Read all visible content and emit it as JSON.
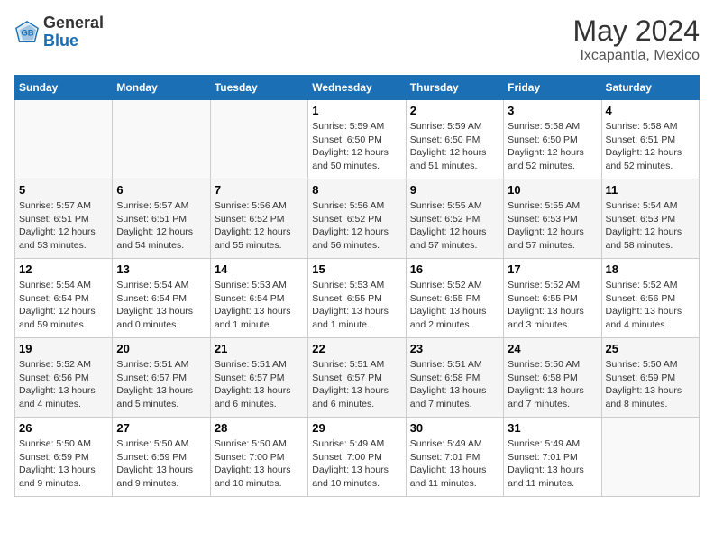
{
  "header": {
    "logo_general": "General",
    "logo_blue": "Blue",
    "month_title": "May 2024",
    "location": "Ixcapantla, Mexico"
  },
  "days_of_week": [
    "Sunday",
    "Monday",
    "Tuesday",
    "Wednesday",
    "Thursday",
    "Friday",
    "Saturday"
  ],
  "weeks": [
    [
      {
        "day": "",
        "content": ""
      },
      {
        "day": "",
        "content": ""
      },
      {
        "day": "",
        "content": ""
      },
      {
        "day": "1",
        "content": "Sunrise: 5:59 AM\nSunset: 6:50 PM\nDaylight: 12 hours\nand 50 minutes."
      },
      {
        "day": "2",
        "content": "Sunrise: 5:59 AM\nSunset: 6:50 PM\nDaylight: 12 hours\nand 51 minutes."
      },
      {
        "day": "3",
        "content": "Sunrise: 5:58 AM\nSunset: 6:50 PM\nDaylight: 12 hours\nand 52 minutes."
      },
      {
        "day": "4",
        "content": "Sunrise: 5:58 AM\nSunset: 6:51 PM\nDaylight: 12 hours\nand 52 minutes."
      }
    ],
    [
      {
        "day": "5",
        "content": "Sunrise: 5:57 AM\nSunset: 6:51 PM\nDaylight: 12 hours\nand 53 minutes."
      },
      {
        "day": "6",
        "content": "Sunrise: 5:57 AM\nSunset: 6:51 PM\nDaylight: 12 hours\nand 54 minutes."
      },
      {
        "day": "7",
        "content": "Sunrise: 5:56 AM\nSunset: 6:52 PM\nDaylight: 12 hours\nand 55 minutes."
      },
      {
        "day": "8",
        "content": "Sunrise: 5:56 AM\nSunset: 6:52 PM\nDaylight: 12 hours\nand 56 minutes."
      },
      {
        "day": "9",
        "content": "Sunrise: 5:55 AM\nSunset: 6:52 PM\nDaylight: 12 hours\nand 57 minutes."
      },
      {
        "day": "10",
        "content": "Sunrise: 5:55 AM\nSunset: 6:53 PM\nDaylight: 12 hours\nand 57 minutes."
      },
      {
        "day": "11",
        "content": "Sunrise: 5:54 AM\nSunset: 6:53 PM\nDaylight: 12 hours\nand 58 minutes."
      }
    ],
    [
      {
        "day": "12",
        "content": "Sunrise: 5:54 AM\nSunset: 6:54 PM\nDaylight: 12 hours\nand 59 minutes."
      },
      {
        "day": "13",
        "content": "Sunrise: 5:54 AM\nSunset: 6:54 PM\nDaylight: 13 hours\nand 0 minutes."
      },
      {
        "day": "14",
        "content": "Sunrise: 5:53 AM\nSunset: 6:54 PM\nDaylight: 13 hours\nand 1 minute."
      },
      {
        "day": "15",
        "content": "Sunrise: 5:53 AM\nSunset: 6:55 PM\nDaylight: 13 hours\nand 1 minute."
      },
      {
        "day": "16",
        "content": "Sunrise: 5:52 AM\nSunset: 6:55 PM\nDaylight: 13 hours\nand 2 minutes."
      },
      {
        "day": "17",
        "content": "Sunrise: 5:52 AM\nSunset: 6:55 PM\nDaylight: 13 hours\nand 3 minutes."
      },
      {
        "day": "18",
        "content": "Sunrise: 5:52 AM\nSunset: 6:56 PM\nDaylight: 13 hours\nand 4 minutes."
      }
    ],
    [
      {
        "day": "19",
        "content": "Sunrise: 5:52 AM\nSunset: 6:56 PM\nDaylight: 13 hours\nand 4 minutes."
      },
      {
        "day": "20",
        "content": "Sunrise: 5:51 AM\nSunset: 6:57 PM\nDaylight: 13 hours\nand 5 minutes."
      },
      {
        "day": "21",
        "content": "Sunrise: 5:51 AM\nSunset: 6:57 PM\nDaylight: 13 hours\nand 6 minutes."
      },
      {
        "day": "22",
        "content": "Sunrise: 5:51 AM\nSunset: 6:57 PM\nDaylight: 13 hours\nand 6 minutes."
      },
      {
        "day": "23",
        "content": "Sunrise: 5:51 AM\nSunset: 6:58 PM\nDaylight: 13 hours\nand 7 minutes."
      },
      {
        "day": "24",
        "content": "Sunrise: 5:50 AM\nSunset: 6:58 PM\nDaylight: 13 hours\nand 7 minutes."
      },
      {
        "day": "25",
        "content": "Sunrise: 5:50 AM\nSunset: 6:59 PM\nDaylight: 13 hours\nand 8 minutes."
      }
    ],
    [
      {
        "day": "26",
        "content": "Sunrise: 5:50 AM\nSunset: 6:59 PM\nDaylight: 13 hours\nand 9 minutes."
      },
      {
        "day": "27",
        "content": "Sunrise: 5:50 AM\nSunset: 6:59 PM\nDaylight: 13 hours\nand 9 minutes."
      },
      {
        "day": "28",
        "content": "Sunrise: 5:50 AM\nSunset: 7:00 PM\nDaylight: 13 hours\nand 10 minutes."
      },
      {
        "day": "29",
        "content": "Sunrise: 5:49 AM\nSunset: 7:00 PM\nDaylight: 13 hours\nand 10 minutes."
      },
      {
        "day": "30",
        "content": "Sunrise: 5:49 AM\nSunset: 7:01 PM\nDaylight: 13 hours\nand 11 minutes."
      },
      {
        "day": "31",
        "content": "Sunrise: 5:49 AM\nSunset: 7:01 PM\nDaylight: 13 hours\nand 11 minutes."
      },
      {
        "day": "",
        "content": ""
      }
    ]
  ]
}
